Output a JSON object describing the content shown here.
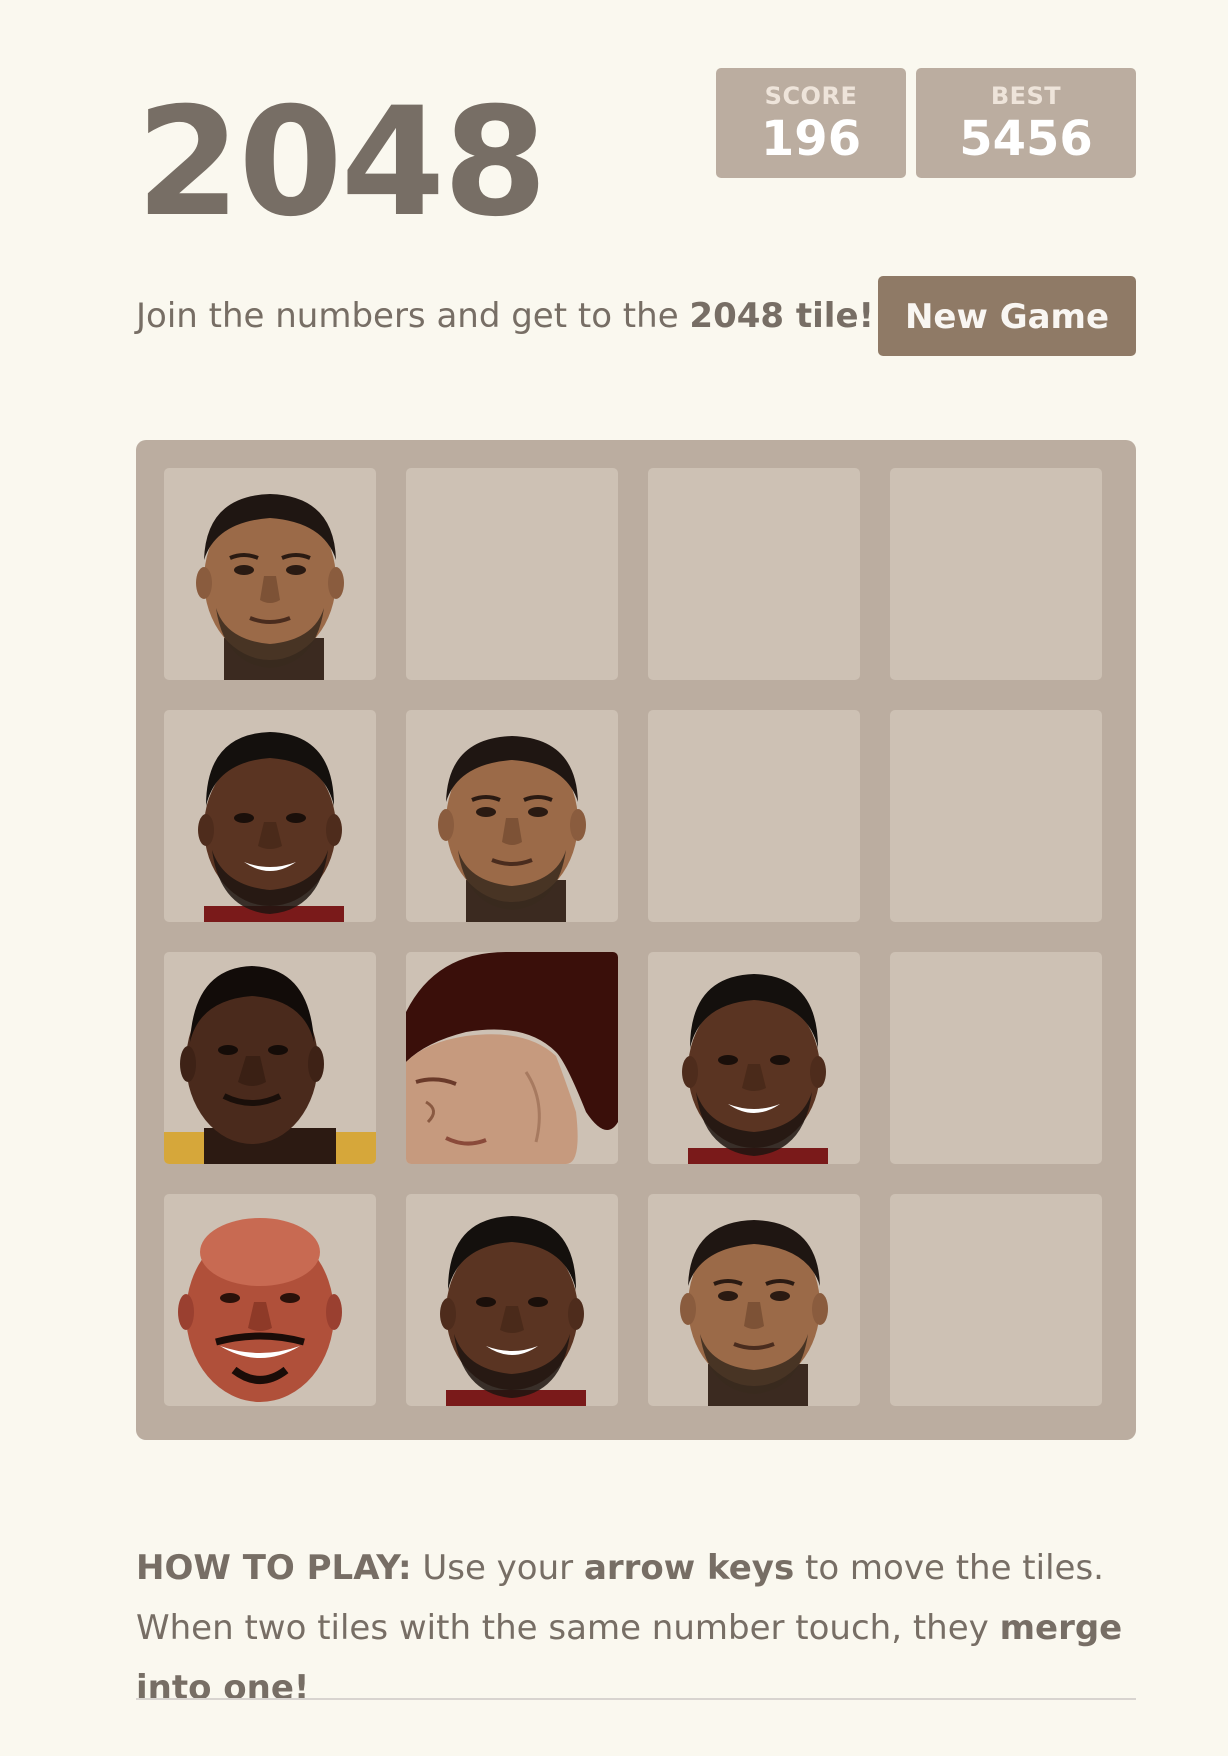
{
  "header": {
    "title": "2048",
    "score_label": "SCORE",
    "score_value": "196",
    "best_label": "BEST",
    "best_value": "5456"
  },
  "intro": {
    "text_before": "Join the numbers and get to the ",
    "bold": "2048 tile!"
  },
  "controls": {
    "new_game_label": "New Game"
  },
  "board": {
    "size": 4,
    "rows": [
      [
        "player-a-face",
        "empty",
        "empty",
        "empty"
      ],
      [
        "player-b-face",
        "player-a-face",
        "empty",
        "empty"
      ],
      [
        "player-c-face",
        "player-d-face",
        "player-b-face",
        "empty"
      ],
      [
        "player-e-face",
        "player-b-face",
        "player-a-face",
        "empty"
      ]
    ]
  },
  "instructions": {
    "label": "HOW TO PLAY:",
    "part1": " Use your ",
    "bold1": "arrow keys",
    "part2": " to move the tiles. When two tiles with the same number touch, they ",
    "bold2": "merge into one!"
  },
  "colors": {
    "background": "#faf8ef",
    "board": "#bbada0",
    "cell": "#cdc1b4",
    "text": "#776e65",
    "button": "#8f7a66"
  }
}
